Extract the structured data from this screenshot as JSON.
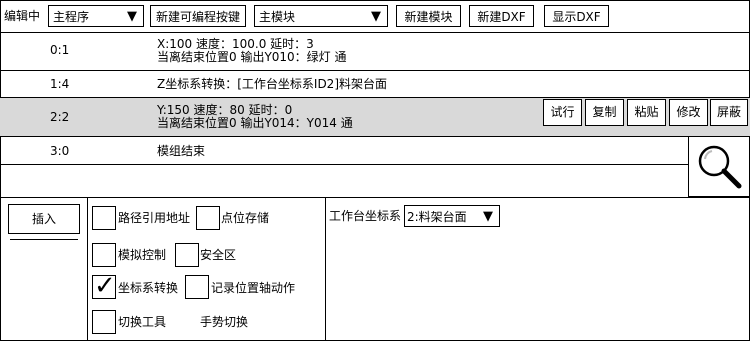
{
  "toolbar": {
    "mode_label": "编辑中",
    "program_select": "主程序",
    "new_program_key": "新建可编程按键",
    "module_select": "主模块",
    "new_module": "新建模块",
    "new_dxf": "新建DXF",
    "show_dxf": "显示DXF"
  },
  "rows": [
    {
      "index": "0:1",
      "line1": "X:100 速度：100.0 延时：3",
      "line2": "当离结束位置0 输出Y010：绿灯 通"
    },
    {
      "index": "1:4",
      "line1": "Z坐标系转换：[工作台坐标系ID2]料架台面"
    },
    {
      "index": "2:2",
      "line1": "Y:150 速度：80 延时：0",
      "line2": "当离结束位置0 输出Y014：Y014 通"
    },
    {
      "index": "3:0",
      "line1": "模组结束"
    }
  ],
  "row_actions": {
    "trial": "试行",
    "copy": "复制",
    "paste": "粘贴",
    "edit": "修改",
    "shield": "屏蔽"
  },
  "insert_label": "插入",
  "options": {
    "path_ref": "路径引用地址",
    "point_store": "点位存储",
    "analog": "模拟控制",
    "safe_zone": "安全区",
    "coord_convert": "坐标系转换",
    "record_axis": "记录位置轴动作",
    "switch_tool": "切换工具",
    "gesture_switch": "手势切换"
  },
  "coord_panel": {
    "label": "工作台坐标系",
    "value": "2:料架台面"
  },
  "colors": {
    "selected_row": "#d9d9d9",
    "border": "#000000"
  }
}
